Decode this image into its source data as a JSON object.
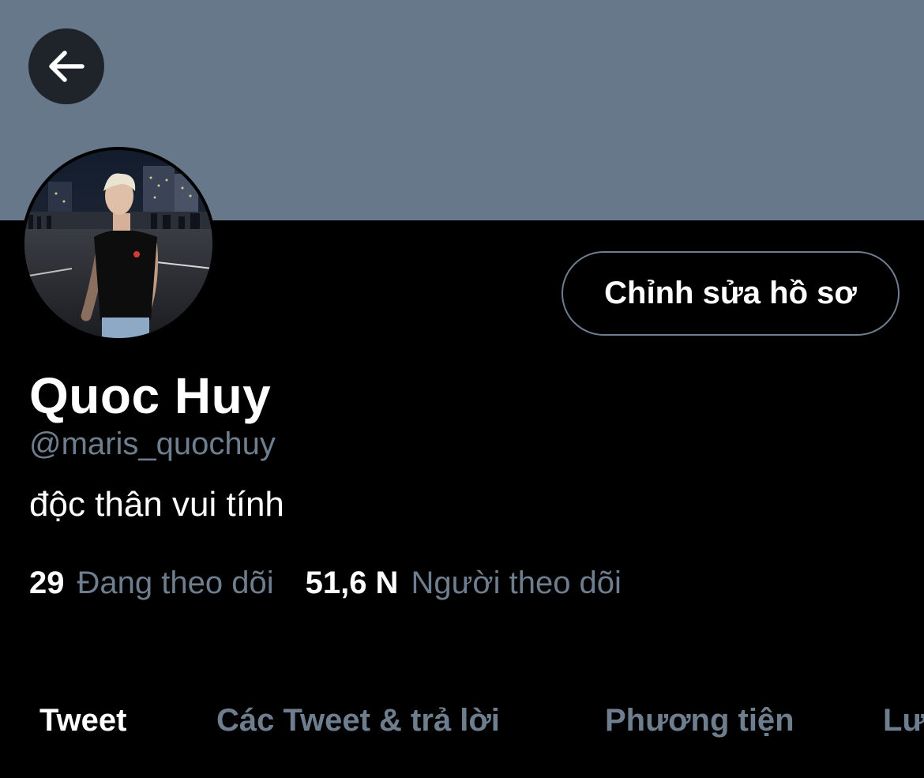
{
  "colors": {
    "background": "#000000",
    "banner": "#66788a",
    "secondary_text": "#6e7e8f",
    "back_button_bg": "#1f242a"
  },
  "header": {
    "back_icon": "arrow-left-icon"
  },
  "profile": {
    "edit_button_label": "Chỉnh sửa hồ sơ",
    "display_name": "Quoc Huy",
    "handle": "@maris_quochuy",
    "bio": "độc thân vui tính",
    "following_count": "29",
    "following_label": "Đang theo dõi",
    "followers_count": "51,6 N",
    "followers_label": "Người theo dõi"
  },
  "tabs": [
    {
      "label": "Tweet",
      "active": true
    },
    {
      "label": "Các Tweet & trả lời",
      "active": false
    },
    {
      "label": "Phương tiện",
      "active": false
    },
    {
      "label": "Lượt thích",
      "active": false
    }
  ]
}
